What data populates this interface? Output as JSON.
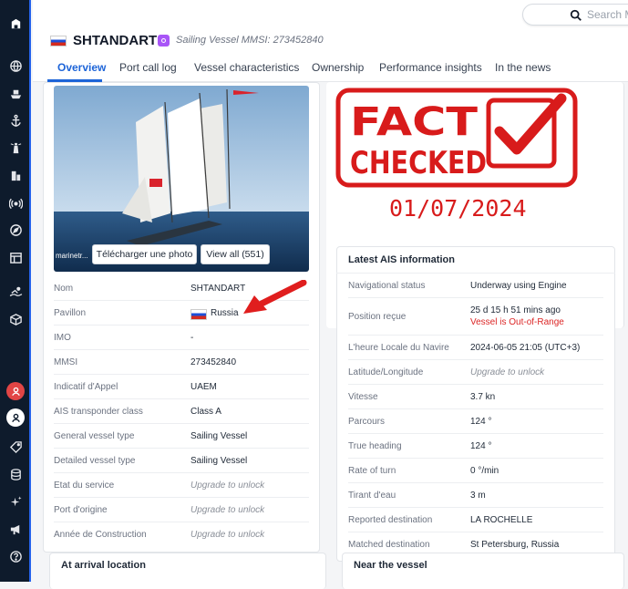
{
  "sidebar": {
    "icons": [
      "logo-icon",
      "globe-icon",
      "ship-icon",
      "anchor-icon",
      "lighthouse-icon",
      "buildings-icon",
      "signal-icon",
      "compass-icon",
      "calendar-icon",
      "swimmer-icon",
      "package-icon",
      "user-alert-icon",
      "user-icon",
      "tag-icon",
      "database-icon",
      "sparkle-icon",
      "megaphone-icon",
      "help-icon"
    ]
  },
  "search": {
    "placeholder": "Search M"
  },
  "vessel": {
    "name": "SHTANDART",
    "type_info": "Sailing Vessel  MMSI: 273452840"
  },
  "tabs": [
    {
      "label": "Overview"
    },
    {
      "label": "Port call log"
    },
    {
      "label": "Vessel characteristics"
    },
    {
      "label": "Ownership"
    },
    {
      "label": "Performance insights"
    },
    {
      "label": "In the news"
    }
  ],
  "photo": {
    "download_label": "Télécharger une photo",
    "view_all_label": "View all (551)",
    "credit": "marinetr..."
  },
  "details": [
    {
      "key": "Nom",
      "value": "SHTANDART"
    },
    {
      "key": "Pavillon",
      "value": "Russia"
    },
    {
      "key": "IMO",
      "value": "-"
    },
    {
      "key": "MMSI",
      "value": "273452840"
    },
    {
      "key": "Indicatif d'Appel",
      "value": "UAEM"
    },
    {
      "key": "AIS transponder class",
      "value": "Class A"
    },
    {
      "key": "General vessel type",
      "value": "Sailing Vessel"
    },
    {
      "key": "Detailed vessel type",
      "value": "Sailing Vessel"
    },
    {
      "key": "Etat du service",
      "value": "Upgrade to unlock"
    },
    {
      "key": "Port d'origine",
      "value": "Upgrade to unlock"
    },
    {
      "key": "Année de Construction",
      "value": "Upgrade to unlock"
    }
  ],
  "stamp": {
    "line1": "FACT",
    "line2": "CHECKED",
    "date": "01/07/2024",
    "color": "#d81b1b"
  },
  "ais": {
    "title": "Latest AIS information",
    "rows": [
      {
        "key": "Navigational status",
        "value": "Underway using Engine"
      },
      {
        "key": "Position reçue",
        "value": "25 d 15 h 51 mins ago",
        "note": "Vessel is Out-of-Range"
      },
      {
        "key": "L'heure Locale du Navire",
        "value": "2024-06-05 21:05 (UTC+3)"
      },
      {
        "key": "Latitude/Longitude",
        "value": "Upgrade to unlock"
      },
      {
        "key": "Vitesse",
        "value": "3.7 kn"
      },
      {
        "key": "Parcours",
        "value": "124 °"
      },
      {
        "key": "True heading",
        "value": "124 °"
      },
      {
        "key": "Rate of turn",
        "value": "0 °/min"
      },
      {
        "key": "Tirant d'eau",
        "value": "3 m"
      },
      {
        "key": "Reported destination",
        "value": "LA ROCHELLE"
      },
      {
        "key": "Matched destination",
        "value": "St Petersburg, Russia"
      }
    ]
  },
  "sections": {
    "arrival": "At arrival location",
    "near": "Near the vessel"
  },
  "colors": {
    "accent": "#1d64d8",
    "sidebar": "#0e1b2c",
    "warning": "#dc2626"
  }
}
